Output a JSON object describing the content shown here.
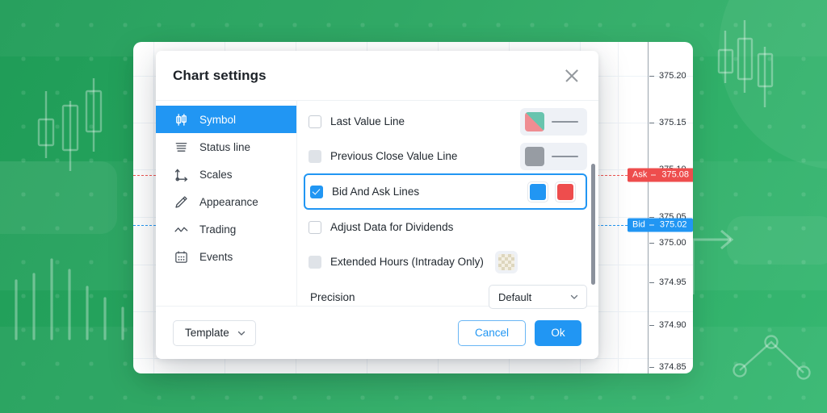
{
  "background": {
    "accent_green_dark": "#1f9c57",
    "accent_green_light": "#36b771",
    "decor": [
      "candlestick-group-left",
      "bar-series-left",
      "circle-right",
      "candlestick-group-right",
      "arrow-right",
      "line-chart-nodes-right"
    ]
  },
  "chart": {
    "price_axis": {
      "ticks": [
        "375.20",
        "375.15",
        "375.10",
        "375.05",
        "375.00",
        "374.95",
        "374.90",
        "374.85"
      ]
    },
    "markers": [
      {
        "tag": "Ask",
        "value": "375.08",
        "color": "#f0534f"
      },
      {
        "tag": "Bid",
        "value": "375.02",
        "color": "#2196f3"
      }
    ]
  },
  "dialog": {
    "title": "Chart settings",
    "close_icon": "close-icon",
    "sidebar": {
      "items": [
        {
          "label": "Symbol",
          "icon": "candlestick-icon",
          "active": true
        },
        {
          "label": "Status line",
          "icon": "status-line-icon",
          "active": false
        },
        {
          "label": "Scales",
          "icon": "axes-icon",
          "active": false
        },
        {
          "label": "Appearance",
          "icon": "pencil-icon",
          "active": false
        },
        {
          "label": "Trading",
          "icon": "zigzag-icon",
          "active": false
        },
        {
          "label": "Events",
          "icon": "calendar-icon",
          "active": false
        }
      ]
    },
    "rows": [
      {
        "label": "Last Value Line",
        "state": "unchecked"
      },
      {
        "label": "Previous Close Value Line",
        "state": "disabled"
      },
      {
        "label": "Bid And Ask Lines",
        "state": "checked"
      },
      {
        "label": "Adjust Data for Dividends",
        "state": "unchecked"
      },
      {
        "label": "Extended Hours (Intraday Only)",
        "state": "disabled"
      }
    ],
    "precision": {
      "label": "Precision",
      "value": "Default",
      "chevron_icon": "chevron-down-icon"
    },
    "colors": {
      "last_value_up": "#68c4ae",
      "last_value_down": "#ef8d92",
      "previous_close": "#979ca3",
      "bid": "#2196f3",
      "ask": "#ee4d4d",
      "line_preview": "#8d949d"
    },
    "footer": {
      "template_label": "Template",
      "template_chevron_icon": "chevron-down-icon",
      "cancel_label": "Cancel",
      "ok_label": "Ok"
    },
    "scrollbar": "vertical-scrollbar"
  }
}
